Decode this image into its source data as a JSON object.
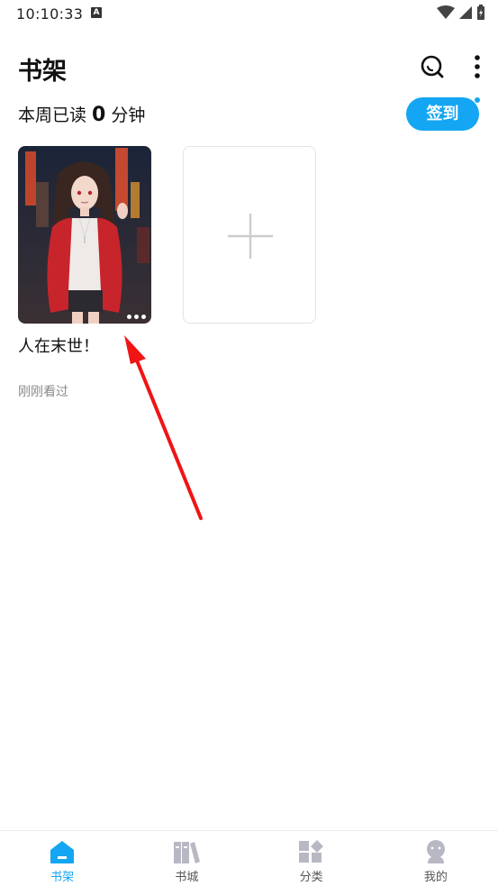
{
  "status_bar": {
    "time": "10:10:33",
    "notification_icon": "A"
  },
  "header": {
    "title": "书架",
    "search_icon": "search-icon",
    "more_icon": "more-vertical-icon"
  },
  "stats": {
    "prefix": "本周已读",
    "minutes": "0",
    "suffix": "分钟"
  },
  "checkin": {
    "label": "签到",
    "color": "#14a6f2"
  },
  "books": [
    {
      "title": "人在末世！",
      "status": "刚刚看过",
      "cover_icon": "anime-girl-cover-image"
    }
  ],
  "add_card": {
    "icon": "plus-icon"
  },
  "bottom_nav": [
    {
      "label": "书架",
      "icon": "bookshelf-home-icon",
      "active": true
    },
    {
      "label": "书城",
      "icon": "bookstore-icon",
      "active": false
    },
    {
      "label": "分类",
      "icon": "category-icon",
      "active": false
    },
    {
      "label": "我的",
      "icon": "profile-icon",
      "active": false
    }
  ],
  "accent_color": "#14a6f2",
  "annotation_color": "#f01414"
}
